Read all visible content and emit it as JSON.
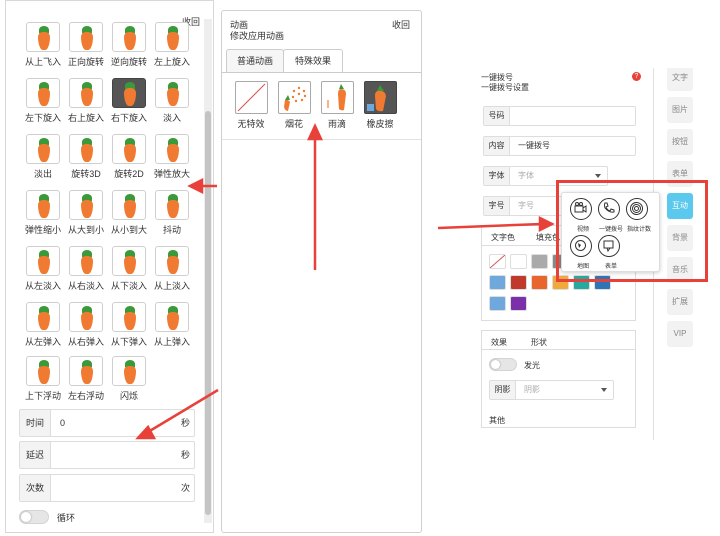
{
  "left_panel": {
    "collapse": "收回",
    "presets": [
      "从上飞入",
      "正向旋转",
      "逆向旋转",
      "左上旋入",
      "左下旋入",
      "右上旋入",
      "右下旋入",
      "淡入",
      "淡出",
      "旋转3D",
      "旋转2D",
      "弹性放大",
      "弹性缩小",
      "从大到小",
      "从小到大",
      "抖动",
      "从左淡入",
      "从右淡入",
      "从下淡入",
      "从上淡入",
      "从左弹入",
      "从右弹入",
      "从下弹入",
      "从上弹入",
      "上下浮动",
      "左右浮动",
      "闪烁"
    ],
    "selected_preset": "右下旋入",
    "fields": {
      "time_label": "时间",
      "time_value": "0",
      "time_unit": "秒",
      "delay_label": "延迟",
      "delay_unit": "秒",
      "count_label": "次数",
      "count_unit": "次",
      "loop_label": "循环"
    }
  },
  "middle_panel": {
    "title": "动画",
    "subtitle": "修改应用动画",
    "collapse": "收回",
    "tabs": [
      "普通动画",
      "特殊效果"
    ],
    "active_tab": "特殊效果",
    "effects": [
      "无特效",
      "烟花",
      "雨滴",
      "橡皮擦"
    ]
  },
  "right_panel": {
    "title": "一键拨号",
    "subtitle": "一键拨号设置",
    "phone_label": "号码",
    "content_label": "内容",
    "content_value": "一键拨号",
    "font_label": "字体",
    "font_placeholder": "字体",
    "size_label": "字号",
    "size_placeholder": "字号",
    "color_tab": "文字色",
    "fill_tab": "填充色",
    "effect_tab": "效果",
    "shape_tab": "形状",
    "glow_label": "发光",
    "shadow_label": "阴影",
    "shadow_placeholder": "阴影",
    "other_label": "其他",
    "side_buttons": [
      "文字",
      "图片",
      "按钮",
      "表单",
      "互动",
      "背景",
      "音乐",
      "扩展",
      "VIP"
    ],
    "active_side": "互动",
    "swatches": [
      "#ffffff",
      "#ffffff",
      "#aaaaaa",
      "#888888",
      "#555555",
      "#333333",
      "#6fa8dc",
      "#c0392b",
      "#e8662e",
      "#f0a93b",
      "#27a9a1",
      "#2e75b6",
      "#6fa8dc",
      "#7b2fa8"
    ]
  },
  "interaction_popup": {
    "items": [
      "视频",
      "一键拨号",
      "指纹计数",
      "地图",
      "表单"
    ]
  },
  "colors": {
    "highlight": "#e8413a",
    "carrot": "#f07a32",
    "leaf": "#3a9a3a",
    "active_side": "#5bc8ee"
  }
}
